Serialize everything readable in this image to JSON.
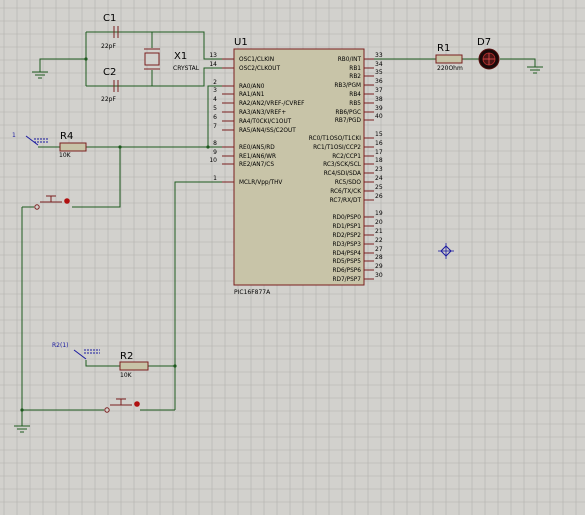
{
  "canvas": {
    "background": "#d2d1cd",
    "grid_color": "#b2b1ad",
    "wire_color": "#1e5a1e",
    "component_color": "#7a1e1e",
    "chip_fill": "#c8c4a8"
  },
  "u1": {
    "ref": "U1",
    "part": "PIC16F877A",
    "left_pins": [
      {
        "num": "13",
        "name": "OSC1/CLKIN"
      },
      {
        "num": "14",
        "name": "OSC2/CLKOUT"
      },
      {
        "num": "2",
        "name": "RA0/AN0"
      },
      {
        "num": "3",
        "name": "RA1/AN1"
      },
      {
        "num": "4",
        "name": "RA2/AN2/VREF-/CVREF"
      },
      {
        "num": "5",
        "name": "RA3/AN3/VREF+"
      },
      {
        "num": "6",
        "name": "RA4/T0CKI/C1OUT"
      },
      {
        "num": "7",
        "name": "RA5/AN4/SS/C2OUT"
      },
      {
        "num": "8",
        "name": "RE0/AN5/RD"
      },
      {
        "num": "9",
        "name": "RE1/AN6/WR"
      },
      {
        "num": "10",
        "name": "RE2/AN7/CS"
      },
      {
        "num": "1",
        "name": "MCLR/Vpp/THV"
      }
    ],
    "right_pins": [
      {
        "num": "33",
        "name": "RB0/INT"
      },
      {
        "num": "34",
        "name": "RB1"
      },
      {
        "num": "35",
        "name": "RB2"
      },
      {
        "num": "36",
        "name": "RB3/PGM"
      },
      {
        "num": "37",
        "name": "RB4"
      },
      {
        "num": "38",
        "name": "RB5"
      },
      {
        "num": "39",
        "name": "RB6/PGC"
      },
      {
        "num": "40",
        "name": "RB7/PGD"
      },
      {
        "num": "15",
        "name": "RC0/T1OSO/T1CKI"
      },
      {
        "num": "16",
        "name": "RC1/T1OSI/CCP2"
      },
      {
        "num": "17",
        "name": "RC2/CCP1"
      },
      {
        "num": "18",
        "name": "RC3/SCK/SCL"
      },
      {
        "num": "23",
        "name": "RC4/SDI/SDA"
      },
      {
        "num": "24",
        "name": "RC5/SDO"
      },
      {
        "num": "25",
        "name": "RC6/TX/CK"
      },
      {
        "num": "26",
        "name": "RC7/RX/DT"
      },
      {
        "num": "19",
        "name": "RD0/PSP0"
      },
      {
        "num": "20",
        "name": "RD1/PSP1"
      },
      {
        "num": "21",
        "name": "RD2/PSP2"
      },
      {
        "num": "22",
        "name": "RD3/PSP3"
      },
      {
        "num": "27",
        "name": "RD4/PSP4"
      },
      {
        "num": "28",
        "name": "RD5/PSP5"
      },
      {
        "num": "29",
        "name": "RD6/PSP6"
      },
      {
        "num": "30",
        "name": "RD7/PSP7"
      }
    ]
  },
  "c1": {
    "ref": "C1",
    "value": "22pF"
  },
  "c2": {
    "ref": "C2",
    "value": "22pF"
  },
  "x1": {
    "ref": "X1",
    "value": "CRYSTAL"
  },
  "r1": {
    "ref": "R1",
    "value": "220Ohm"
  },
  "d7": {
    "ref": "D7"
  },
  "r4": {
    "ref": "R4",
    "value": "10K"
  },
  "r2": {
    "ref": "R2",
    "value": "10K"
  },
  "term1": {
    "label": "1"
  },
  "term2": {
    "label": "R2(1)"
  }
}
